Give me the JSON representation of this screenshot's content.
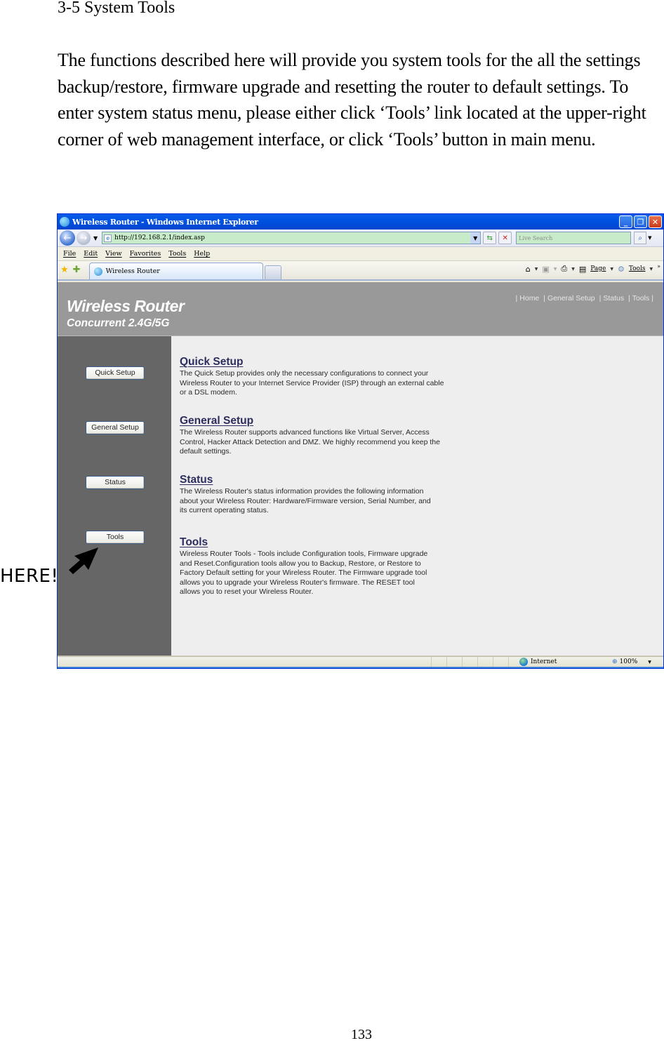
{
  "document": {
    "heading": "3-5 System Tools",
    "paragraph": "The functions described here will provide you system tools for the all the settings backup/restore, firmware upgrade and resetting the router to default settings. To enter system status menu, please either click ‘Tools’ link located at the upper-right corner of web management interface, or click ‘Tools’ button in main menu.",
    "page_number": "133",
    "annotation": "HERE!"
  },
  "browser": {
    "window_title": "Wireless Router - Windows Internet Explorer",
    "window_buttons": {
      "minimize": "_",
      "restore": "❐",
      "close": "✕"
    },
    "address_url": "http://192.168.2.1/index.asp",
    "search_placeholder": "Live Search",
    "menu": [
      "File",
      "Edit",
      "View",
      "Favorites",
      "Tools",
      "Help"
    ],
    "tab_title": "Wireless Router",
    "command_bar": {
      "page_label": "Page",
      "tools_label": "Tools",
      "more": "»"
    },
    "status": {
      "zone": "Internet",
      "zoom": "100%"
    }
  },
  "router": {
    "brand_title": "Wireless Router",
    "brand_subtitle": "Concurrent 2.4G/5G",
    "top_links": [
      "Home",
      "General Setup",
      "Status",
      "Tools"
    ],
    "sidebar_buttons": [
      "Quick Setup",
      "General Setup",
      "Status",
      "Tools"
    ],
    "sections": [
      {
        "title": "Quick Setup",
        "body": "The Quick Setup provides only the necessary configurations to connect your Wireless Router to your Internet Service Provider (ISP) through an external cable or a DSL modem."
      },
      {
        "title": "General Setup",
        "body": "The Wireless Router supports advanced functions like Virtual Server, Access Control, Hacker Attack Detection and DMZ. We highly recommend you keep the default settings."
      },
      {
        "title": "Status",
        "body": "The Wireless Router's status information provides the following information about your Wireless Router: Hardware/Firmware version, Serial Number, and its current operating status."
      },
      {
        "title": "Tools",
        "body": "Wireless Router Tools - Tools include Configuration tools, Firmware upgrade and Reset.Configuration tools allow you to Backup, Restore, or Restore to Factory Default setting for your Wireless Router. The Firmware upgrade tool allows you to upgrade your Wireless Router's firmware. The RESET tool allows you to reset your Wireless Router."
      }
    ]
  }
}
